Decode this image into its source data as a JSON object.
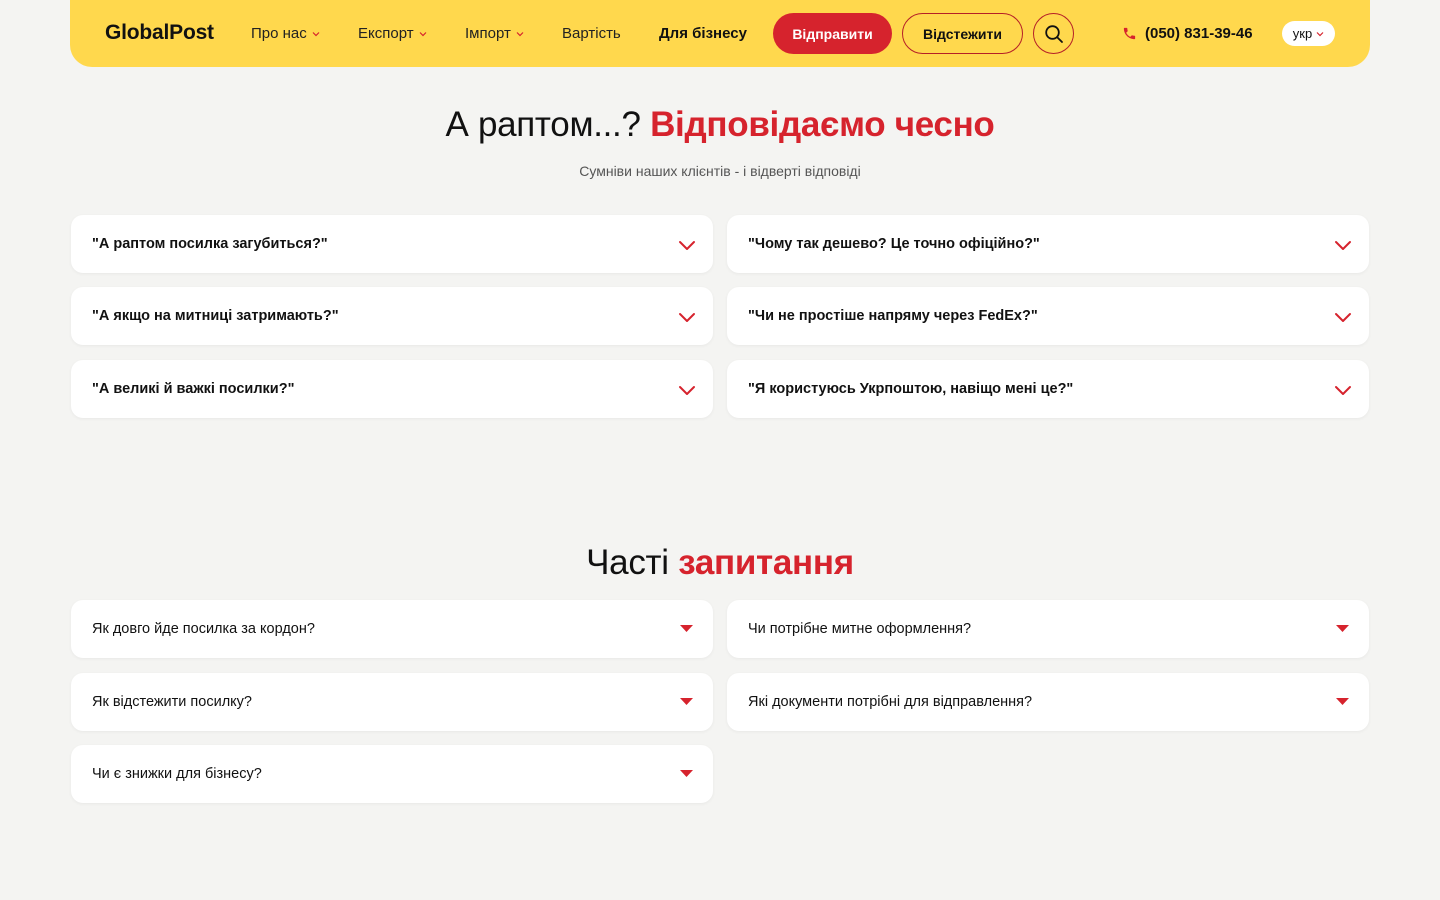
{
  "header": {
    "logo": "GlobalPost",
    "nav": [
      {
        "label": "Про нас",
        "has_dropdown": true
      },
      {
        "label": "Експорт",
        "has_dropdown": true
      },
      {
        "label": "Імпорт",
        "has_dropdown": true
      },
      {
        "label": "Вартість",
        "has_dropdown": false
      },
      {
        "label": "Для бізнесу",
        "has_dropdown": false
      }
    ],
    "send_button": "Відправити",
    "track_button": "Відстежити",
    "search_icon": "search-icon",
    "phone_icon": "phone-icon",
    "phone": "(050) 831-39-46",
    "language": "укр"
  },
  "doubts": {
    "title_plain": "А раптом...?",
    "title_accent": "Відповідаємо чесно",
    "subtitle": "Сумніви наших клієнтів - і відверті відповіді",
    "items": [
      "\"А раптом посилка загубиться?\"",
      "\"Чому так дешево? Це точно офіційно?\"",
      "\"А якщо на митниці затримають?\"",
      "\"Чи не простіше напряму через FedEx?\"",
      "\"А великі й важкі посилки?\"",
      "\"Я користуюсь Укрпоштою, навіщо мені це?\""
    ]
  },
  "faq": {
    "title_plain": "Часті",
    "title_accent": "запитання",
    "items": [
      "Як довго йде посилка за кордон?",
      "Чи потрібне митне оформлення?",
      "Як відстежити посилку?",
      "Які документи потрібні для відправлення?",
      "Чи є знижки для бізнесу?"
    ]
  },
  "colors": {
    "brand_yellow": "#ffd84d",
    "accent_red": "#d6232d",
    "background": "#f4f4f2"
  }
}
